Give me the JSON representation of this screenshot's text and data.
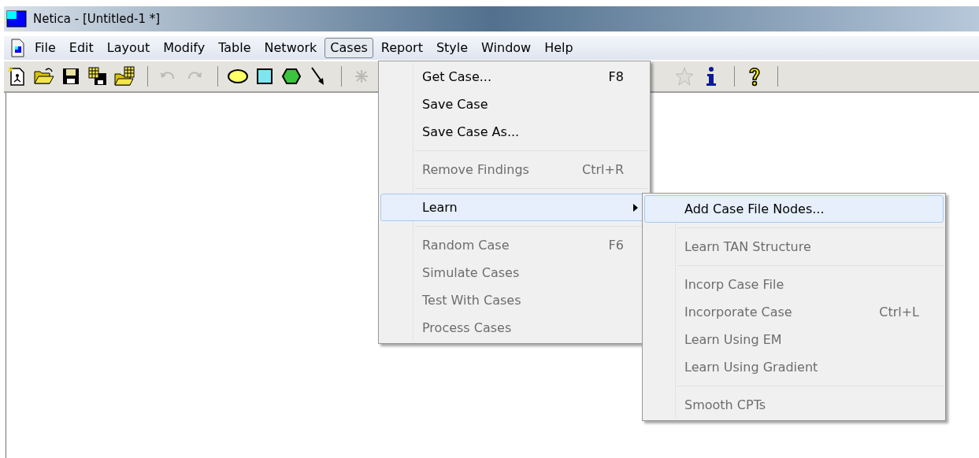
{
  "window": {
    "title": "Netica - [Untitled-1 *]"
  },
  "menubar": [
    {
      "label": "File",
      "selected": false
    },
    {
      "label": "Edit",
      "selected": false
    },
    {
      "label": "Layout",
      "selected": false
    },
    {
      "label": "Modify",
      "selected": false
    },
    {
      "label": "Table",
      "selected": false
    },
    {
      "label": "Network",
      "selected": false
    },
    {
      "label": "Cases",
      "selected": true
    },
    {
      "label": "Report",
      "selected": false
    },
    {
      "label": "Style",
      "selected": false
    },
    {
      "label": "Window",
      "selected": false
    },
    {
      "label": "Help",
      "selected": false
    }
  ],
  "toolbar": [
    {
      "kind": "new",
      "disabled": false
    },
    {
      "kind": "open",
      "disabled": false
    },
    {
      "kind": "save",
      "disabled": false
    },
    {
      "kind": "save-table",
      "disabled": false
    },
    {
      "kind": "open-table",
      "disabled": false
    },
    {
      "kind": "separator"
    },
    {
      "kind": "undo",
      "disabled": true
    },
    {
      "kind": "redo",
      "disabled": true
    },
    {
      "kind": "separator"
    },
    {
      "kind": "ellipse",
      "disabled": false
    },
    {
      "kind": "rectangle",
      "disabled": false
    },
    {
      "kind": "hexagon",
      "disabled": false
    },
    {
      "kind": "arrow",
      "disabled": false
    },
    {
      "kind": "separator"
    },
    {
      "kind": "spark",
      "disabled": true
    },
    {
      "kind": "gap"
    },
    {
      "kind": "star",
      "disabled": true
    },
    {
      "kind": "info",
      "disabled": false
    },
    {
      "kind": "separator"
    },
    {
      "kind": "help",
      "disabled": false
    },
    {
      "kind": "separator"
    }
  ],
  "cases_menu": [
    {
      "kind": "item",
      "label": "Get Case...",
      "shortcut": "F8",
      "disabled": false,
      "selected": false
    },
    {
      "kind": "item",
      "label": "Save Case",
      "disabled": false,
      "selected": false
    },
    {
      "kind": "item",
      "label": "Save Case As...",
      "disabled": false,
      "selected": false
    },
    {
      "kind": "separator"
    },
    {
      "kind": "item",
      "label": "Remove Findings",
      "shortcut": "Ctrl+R",
      "disabled": true,
      "selected": false
    },
    {
      "kind": "separator"
    },
    {
      "kind": "submenu",
      "label": "Learn",
      "disabled": false,
      "selected": true
    },
    {
      "kind": "separator"
    },
    {
      "kind": "item",
      "label": "Random Case",
      "shortcut": "F6",
      "disabled": true,
      "selected": false
    },
    {
      "kind": "item",
      "label": "Simulate Cases",
      "disabled": true,
      "selected": false
    },
    {
      "kind": "item",
      "label": "Test With Cases",
      "disabled": true,
      "selected": false
    },
    {
      "kind": "item",
      "label": "Process Cases",
      "disabled": true,
      "selected": false
    }
  ],
  "learn_submenu": [
    {
      "kind": "item",
      "label": "Add Case File Nodes...",
      "disabled": false,
      "selected": true
    },
    {
      "kind": "separator"
    },
    {
      "kind": "item",
      "label": "Learn TAN Structure",
      "disabled": true,
      "selected": false
    },
    {
      "kind": "separator"
    },
    {
      "kind": "item",
      "label": "Incorp Case File",
      "disabled": true,
      "selected": false
    },
    {
      "kind": "item",
      "label": "Incorporate Case",
      "shortcut": "Ctrl+L",
      "disabled": true,
      "selected": false
    },
    {
      "kind": "item",
      "label": "Learn Using EM",
      "disabled": true,
      "selected": false
    },
    {
      "kind": "item",
      "label": "Learn Using Gradient",
      "disabled": true,
      "selected": false
    },
    {
      "kind": "separator"
    },
    {
      "kind": "item",
      "label": "Smooth CPTs",
      "disabled": true,
      "selected": false
    }
  ]
}
